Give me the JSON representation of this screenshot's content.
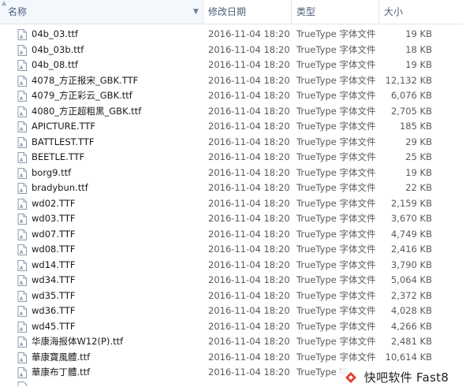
{
  "columns": {
    "name": "名称",
    "date": "修改日期",
    "type": "类型",
    "size": "大小"
  },
  "files": [
    {
      "name": "04b_03.ttf",
      "date": "2016-11-04 18:20",
      "type": "TrueType 字体文件",
      "size": "19 KB"
    },
    {
      "name": "04b_03b.ttf",
      "date": "2016-11-04 18:20",
      "type": "TrueType 字体文件",
      "size": "18 KB"
    },
    {
      "name": "04b_08.ttf",
      "date": "2016-11-04 18:20",
      "type": "TrueType 字体文件",
      "size": "19 KB"
    },
    {
      "name": "4078_方正报宋_GBK.TTF",
      "date": "2016-11-04 18:20",
      "type": "TrueType 字体文件",
      "size": "12,132 KB"
    },
    {
      "name": "4079_方正彩云_GBK.ttf",
      "date": "2016-11-04 18:20",
      "type": "TrueType 字体文件",
      "size": "6,076 KB"
    },
    {
      "name": "4080_方正超粗黑_GBK.ttf",
      "date": "2016-11-04 18:20",
      "type": "TrueType 字体文件",
      "size": "2,705 KB"
    },
    {
      "name": "APICTURE.TTF",
      "date": "2016-11-04 18:20",
      "type": "TrueType 字体文件",
      "size": "185 KB"
    },
    {
      "name": "BATTLEST.TTF",
      "date": "2016-11-04 18:20",
      "type": "TrueType 字体文件",
      "size": "29 KB"
    },
    {
      "name": "BEETLE.TTF",
      "date": "2016-11-04 18:20",
      "type": "TrueType 字体文件",
      "size": "25 KB"
    },
    {
      "name": "borg9.ttf",
      "date": "2016-11-04 18:20",
      "type": "TrueType 字体文件",
      "size": "19 KB"
    },
    {
      "name": "bradybun.ttf",
      "date": "2016-11-04 18:20",
      "type": "TrueType 字体文件",
      "size": "22 KB"
    },
    {
      "name": "wd02.TTF",
      "date": "2016-11-04 18:20",
      "type": "TrueType 字体文件",
      "size": "2,159 KB"
    },
    {
      "name": "wd03.TTF",
      "date": "2016-11-04 18:20",
      "type": "TrueType 字体文件",
      "size": "3,670 KB"
    },
    {
      "name": "wd07.TTF",
      "date": "2016-11-04 18:20",
      "type": "TrueType 字体文件",
      "size": "4,749 KB"
    },
    {
      "name": "wd08.TTF",
      "date": "2016-11-04 18:20",
      "type": "TrueType 字体文件",
      "size": "2,416 KB"
    },
    {
      "name": "wd14.TTF",
      "date": "2016-11-04 18:20",
      "type": "TrueType 字体文件",
      "size": "3,790 KB"
    },
    {
      "name": "wd34.TTF",
      "date": "2016-11-04 18:20",
      "type": "TrueType 字体文件",
      "size": "5,064 KB"
    },
    {
      "name": "wd35.TTF",
      "date": "2016-11-04 18:20",
      "type": "TrueType 字体文件",
      "size": "2,372 KB"
    },
    {
      "name": "wd36.TTF",
      "date": "2016-11-04 18:20",
      "type": "TrueType 字体文件",
      "size": "4,028 KB"
    },
    {
      "name": "wd45.TTF",
      "date": "2016-11-04 18:20",
      "type": "TrueType 字体文件",
      "size": "4,266 KB"
    },
    {
      "name": "华康海报体W12(P).ttf",
      "date": "2016-11-04 18:20",
      "type": "TrueType 字体文件",
      "size": "2,481 KB"
    },
    {
      "name": "華康寶風體.ttf",
      "date": "2016-11-04 18:20",
      "type": "TrueType 字体文件",
      "size": "10,614 KB"
    },
    {
      "name": "華康布丁體.ttf",
      "date": "2016-11-04 18:20",
      "type": "TrueType 字",
      "size": ""
    }
  ],
  "watermark": {
    "text": "快吧软件 Fast8",
    "icon": "fast8-logo-icon"
  },
  "colors": {
    "header_text": "#4c607a",
    "name_text": "#1a1a1a",
    "detail_text": "#5a5a5a",
    "sorted_column_bg": "#f3f8fd"
  }
}
